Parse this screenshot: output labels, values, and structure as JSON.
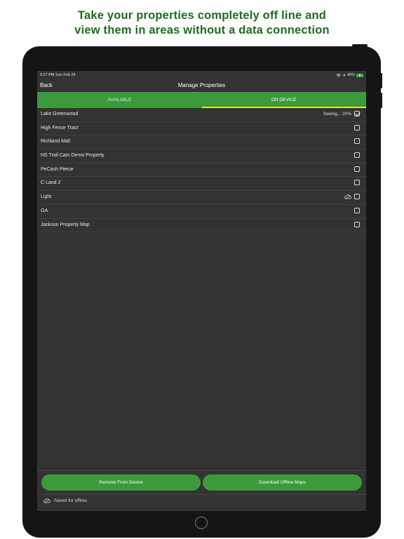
{
  "headline": {
    "line1": "Take your properties completely off line and",
    "line2": "view them in areas without a data connection"
  },
  "status_bar": {
    "time": "9:27 PM  Sun Feb 24",
    "battery": "96%"
  },
  "nav": {
    "back": "Back",
    "title": "Manage Properties"
  },
  "tabs": [
    {
      "label": "AVAILABLE",
      "active": false
    },
    {
      "label": "ON DEVICE",
      "active": true
    }
  ],
  "properties": [
    {
      "name": "Lake Greenwood",
      "status": "Saving... 20%",
      "checked": true,
      "saved_icon": false
    },
    {
      "name": "High Fence Tract",
      "status": "",
      "checked": false,
      "saved_icon": false
    },
    {
      "name": "Richland Mall",
      "status": "",
      "checked": false,
      "saved_icon": false
    },
    {
      "name": "HS Trail Cam Demo Property",
      "status": "",
      "checked": false,
      "saved_icon": false
    },
    {
      "name": "PeCash Pierce",
      "status": "",
      "checked": false,
      "saved_icon": false
    },
    {
      "name": "C Land 2",
      "status": "",
      "checked": false,
      "saved_icon": false
    },
    {
      "name": "Light",
      "status": "",
      "checked": false,
      "saved_icon": true
    },
    {
      "name": "GA",
      "status": "",
      "checked": false,
      "saved_icon": false
    },
    {
      "name": "Jackson Property Map",
      "status": "",
      "checked": false,
      "saved_icon": false
    }
  ],
  "buttons": {
    "remove": "Remove From Device",
    "download": "Download Offline Maps"
  },
  "legend": {
    "text": "Saved for offline."
  },
  "colors": {
    "accent": "#3c9a3c",
    "headline": "#1e6b1e",
    "screen_bg": "#333333",
    "tab_indicator": "#e8e335"
  }
}
